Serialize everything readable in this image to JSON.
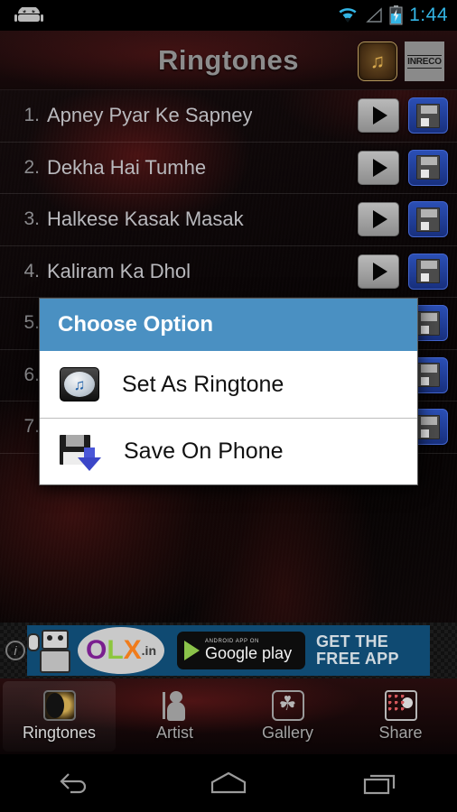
{
  "status_bar": {
    "time": "1:44",
    "icons": [
      "android-robot-icon",
      "wifi-icon",
      "signal-icon",
      "battery-charging-icon"
    ]
  },
  "header": {
    "title": "Ringtones",
    "logo_music_glyph": "♫",
    "logo_label": "INRECO"
  },
  "list": {
    "rows": [
      {
        "index": "1.",
        "title": "Apney Pyar Ke Sapney"
      },
      {
        "index": "2.",
        "title": "Dekha Hai Tumhe"
      },
      {
        "index": "3.",
        "title": "Halkese Kasak Masak"
      },
      {
        "index": "4.",
        "title": "Kaliram Ka Dhol"
      },
      {
        "index": "5.",
        "title": ""
      },
      {
        "index": "6.",
        "title": ""
      },
      {
        "index": "7.",
        "title": ""
      }
    ],
    "play_icon": "play-icon",
    "save_icon": "floppy-disk-icon"
  },
  "dialog": {
    "title": "Choose Option",
    "header_color": "#4a90c2",
    "options": [
      {
        "label": "Set As Ringtone",
        "icon": "music-note-icon",
        "glyph": "♫"
      },
      {
        "label": "Save On Phone",
        "icon": "save-download-icon"
      }
    ]
  },
  "ad": {
    "info_glyph": "i",
    "brand_o": "O",
    "brand_l": "L",
    "brand_x": "X",
    "brand_suffix": ".in",
    "store_small": "ANDROID APP ON",
    "store_big": "Google play",
    "cta_line1": "GET THE",
    "cta_line2": "FREE APP"
  },
  "tabs": [
    {
      "label": "Ringtones",
      "icon": "ringtones-icon",
      "selected": true
    },
    {
      "label": "Artist",
      "icon": "artist-icon",
      "selected": false
    },
    {
      "label": "Gallery",
      "icon": "gallery-icon",
      "selected": false
    },
    {
      "label": "Share",
      "icon": "share-icon",
      "selected": false
    }
  ],
  "navbar": {
    "back": "back-icon",
    "home": "home-icon",
    "recents": "recents-icon"
  }
}
